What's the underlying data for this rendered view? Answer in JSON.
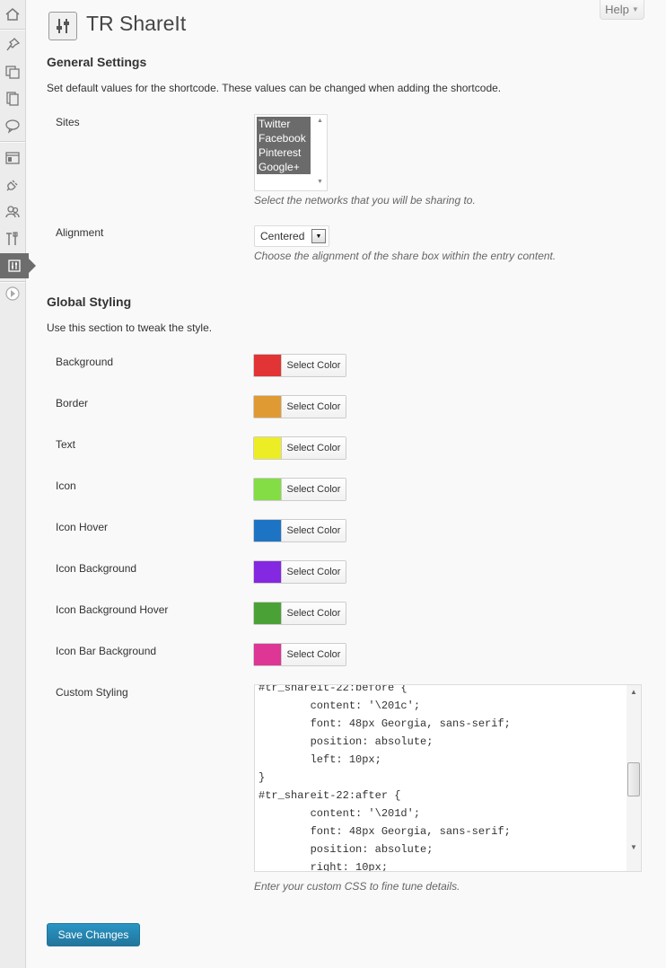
{
  "help": {
    "label": "Help"
  },
  "page": {
    "title": "TR ShareIt"
  },
  "general": {
    "title": "General Settings",
    "description": "Set default values for the shortcode. These values can be changed when adding the shortcode.",
    "sites": {
      "label": "Sites",
      "options": [
        "Twitter",
        "Facebook",
        "Pinterest",
        "Google+"
      ],
      "hint": "Select the networks that you will be sharing to."
    },
    "alignment": {
      "label": "Alignment",
      "value": "Centered",
      "hint": "Choose the alignment of the share box within the entry content."
    }
  },
  "styling": {
    "title": "Global Styling",
    "description": "Use this section to tweak the style.",
    "select_label": "Select Color",
    "colors": [
      {
        "label": "Background",
        "color": "#e23434"
      },
      {
        "label": "Border",
        "color": "#e09a34"
      },
      {
        "label": "Text",
        "color": "#eded26"
      },
      {
        "label": "Icon",
        "color": "#84dd44"
      },
      {
        "label": "Icon Hover",
        "color": "#1e74c4"
      },
      {
        "label": "Icon Background",
        "color": "#8428e2"
      },
      {
        "label": "Icon Background Hover",
        "color": "#4aa237"
      },
      {
        "label": "Icon Bar Background",
        "color": "#dd3694"
      }
    ],
    "custom": {
      "label": "Custom Styling",
      "code": "#tr_shareit-22:before {\n        content: '\\201c';\n        font: 48px Georgia, sans-serif;\n        position: absolute;\n        left: 10px;\n}\n#tr_shareit-22:after {\n        content: '\\201d';\n        font: 48px Georgia, sans-serif;\n        position: absolute;\n        right: 10px;",
      "hint": "Enter your custom CSS to fine tune details."
    }
  },
  "save": {
    "label": "Save Changes"
  },
  "theme": {
    "accent": "#21759b",
    "selected_option": "#6b6b6b"
  }
}
